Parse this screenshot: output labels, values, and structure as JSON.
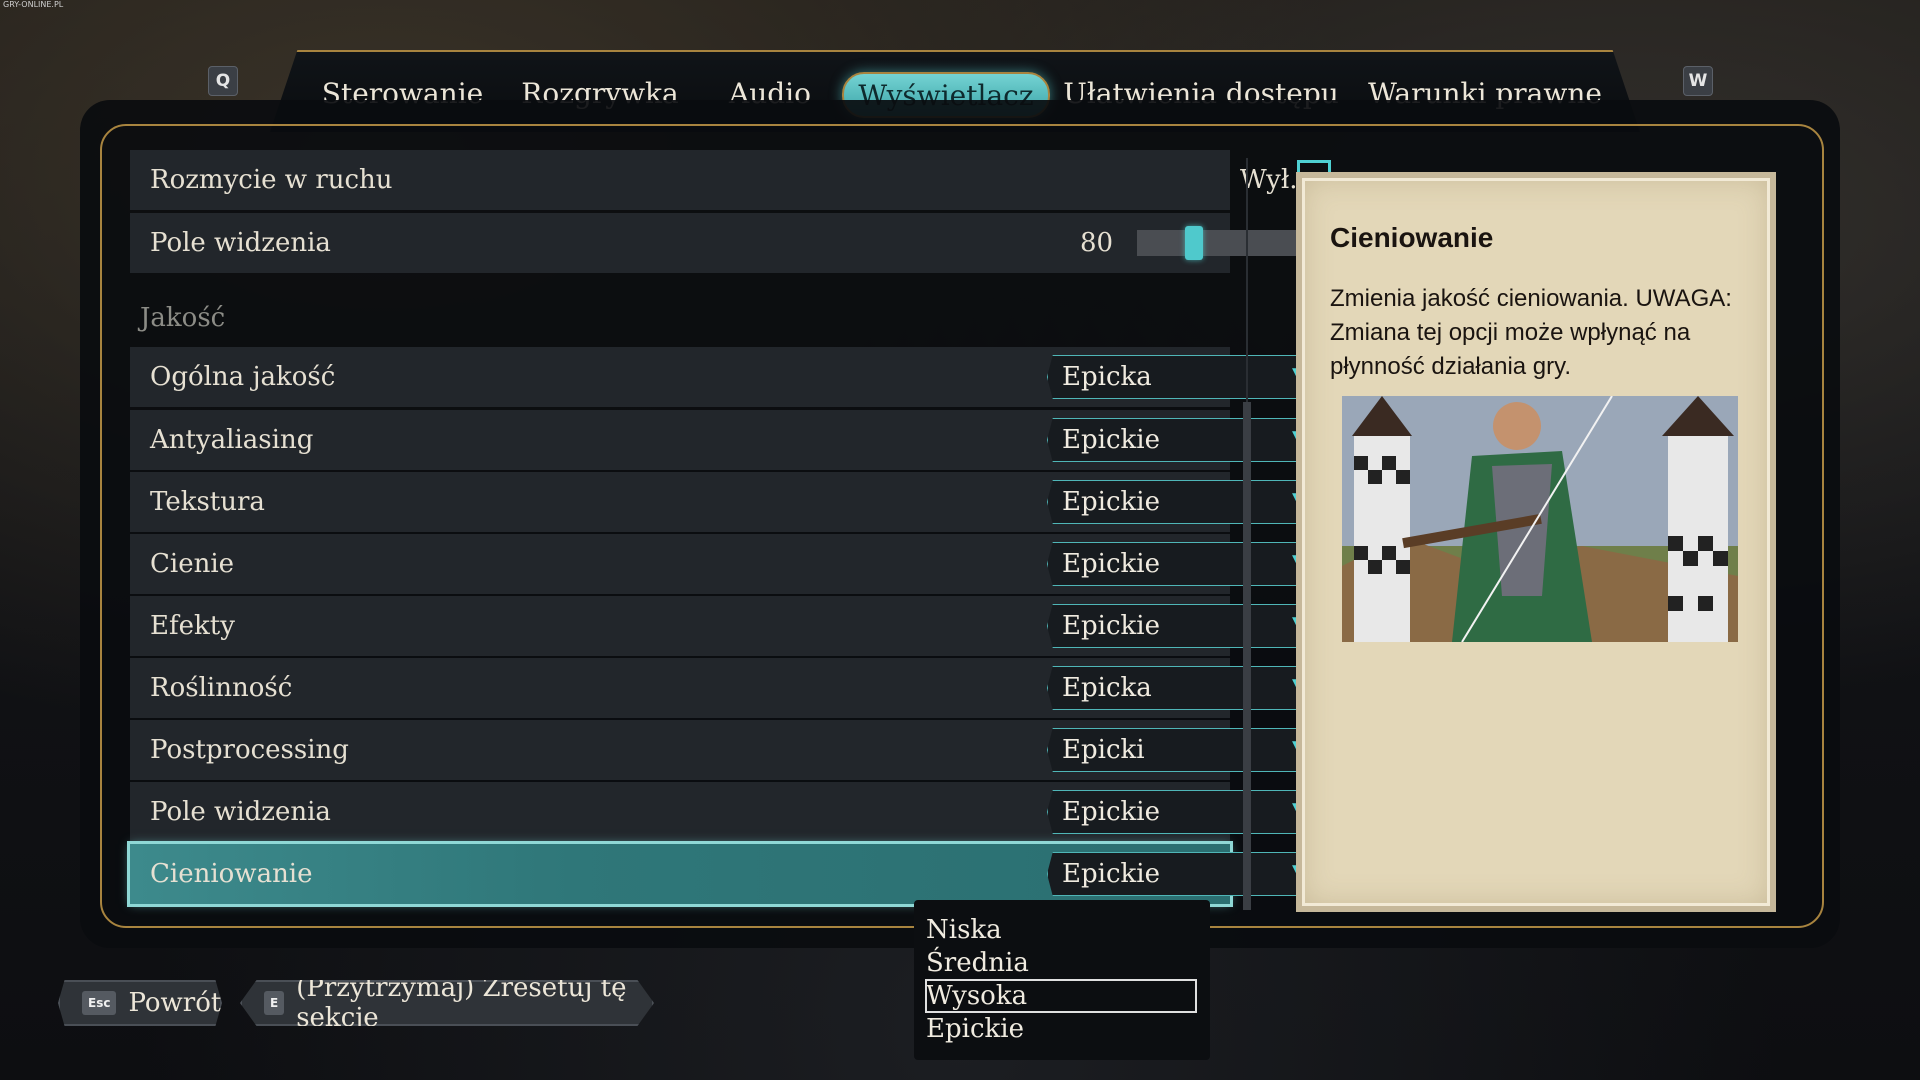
{
  "watermark": "GRY-ONLINE.PL",
  "tabs": {
    "left_key": "Q",
    "right_key": "W",
    "items": [
      {
        "label": "Sterowanie"
      },
      {
        "label": "Rozgrywka"
      },
      {
        "label": "Audio"
      },
      {
        "label": "Wyświetlacz",
        "active": true
      },
      {
        "label": "Ułatwienia dostępu"
      },
      {
        "label": "Warunki prawne"
      }
    ]
  },
  "settings": {
    "motion_blur": {
      "label": "Rozmycie w ruchu",
      "state_text": "Wył.",
      "checked": false
    },
    "fov": {
      "label": "Pole widzenia",
      "value": "80",
      "fill_fraction": 0.27
    },
    "quality_section": "Jakość",
    "quality_rows": [
      {
        "label": "Ogólna jakość",
        "value": "Epicka"
      },
      {
        "label": "Antyaliasing",
        "value": "Epickie"
      },
      {
        "label": "Tekstura",
        "value": "Epickie"
      },
      {
        "label": "Cienie",
        "value": "Epickie"
      },
      {
        "label": "Efekty",
        "value": "Epickie"
      },
      {
        "label": "Roślinność",
        "value": "Epicka"
      },
      {
        "label": "Postprocessing",
        "value": "Epicki"
      },
      {
        "label": "Pole widzenia",
        "value": "Epickie"
      },
      {
        "label": "Cieniowanie",
        "value": "Epickie",
        "selected": true
      }
    ]
  },
  "dropdown_list": {
    "options": [
      "Niska",
      "Średnia",
      "Wysoka",
      "Epickie"
    ],
    "highlighted": "Wysoka"
  },
  "info_card": {
    "title": "Cieniowanie",
    "description": "Zmienia jakość cieniowania. UWAGA: Zmiana tej opcji może wpłynąć na płynność działania gry."
  },
  "footer": {
    "back_key": "Esc",
    "back_label": "Powrót",
    "reset_key": "E",
    "reset_label": "(Przytrzymaj) Zresetuj tę sekcję"
  },
  "colors": {
    "accent_cyan": "#4fd0d2",
    "gold_frame": "#a8843f",
    "parchment": "#e3d7b8"
  }
}
